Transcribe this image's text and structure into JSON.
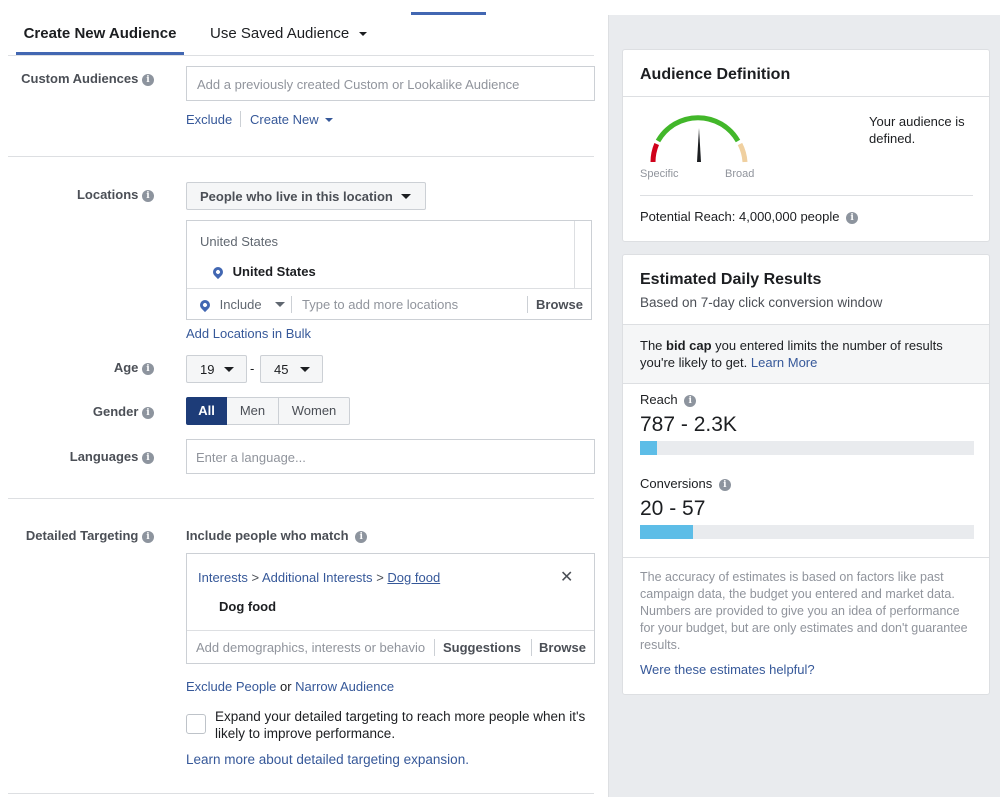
{
  "tabs": {
    "create_new": "Create New Audience",
    "use_saved": "Use Saved Audience"
  },
  "custom_audiences": {
    "label": "Custom Audiences",
    "placeholder": "Add a previously created Custom or Lookalike Audience",
    "exclude": "Exclude",
    "create_new": "Create New"
  },
  "locations": {
    "label": "Locations",
    "dropdown": "People who live in this location",
    "group": "United States",
    "item": "United States",
    "include": "Include",
    "placeholder": "Type to add more locations",
    "browse": "Browse",
    "add_bulk": "Add Locations in Bulk"
  },
  "age": {
    "label": "Age",
    "min": "19",
    "separator": "-",
    "max": "45"
  },
  "gender": {
    "label": "Gender",
    "options": [
      "All",
      "Men",
      "Women"
    ],
    "selected": "All"
  },
  "languages": {
    "label": "Languages",
    "placeholder": "Enter a language..."
  },
  "detailed_targeting": {
    "label": "Detailed Targeting",
    "include_label": "Include people who match",
    "breadcrumb": [
      "Interests",
      ">",
      "Additional Interests",
      ">",
      "Dog food"
    ],
    "selected_item": "Dog food",
    "placeholder": "Add demographics, interests or behavio",
    "suggestions": "Suggestions",
    "browse": "Browse",
    "exclude_people": "Exclude People",
    "or": "or",
    "narrow": "Narrow Audience",
    "expand_text": "Expand your detailed targeting to reach more people when it's likely to improve performance.",
    "learn_more": "Learn more about detailed targeting expansion."
  },
  "audience_definition": {
    "title": "Audience Definition",
    "status": "Your audience is defined.",
    "specific": "Specific",
    "broad": "Broad",
    "potential_reach": "Potential Reach: 4,000,000 people",
    "gauge_position": 0.5
  },
  "daily_results": {
    "title": "Estimated Daily Results",
    "subtitle": "Based on 7-day click conversion window",
    "notice_pre": "The",
    "notice_bold": "bid cap",
    "notice_post": "you entered limits the number of results you're likely to get.",
    "learn_more": "Learn More",
    "reach_label": "Reach",
    "reach_value": "787 - 2.3K",
    "reach_fill": 0.05,
    "conversions_label": "Conversions",
    "conversions_value": "20 - 57",
    "conversions_fill": 0.16,
    "disclaimer": "The accuracy of estimates is based on factors like past campaign data, the budget you entered and market data. Numbers are provided to give you an idea of performance for your budget, but are only estimates and don't guarantee results.",
    "helpful": "Were these estimates helpful?"
  },
  "colors": {
    "accent": "#4267b2",
    "link": "#365899",
    "bar": "#5dbde7",
    "gauge_red": "#d0021b",
    "gauge_green": "#42b72a",
    "gauge_tan": "#f0d0a0"
  }
}
